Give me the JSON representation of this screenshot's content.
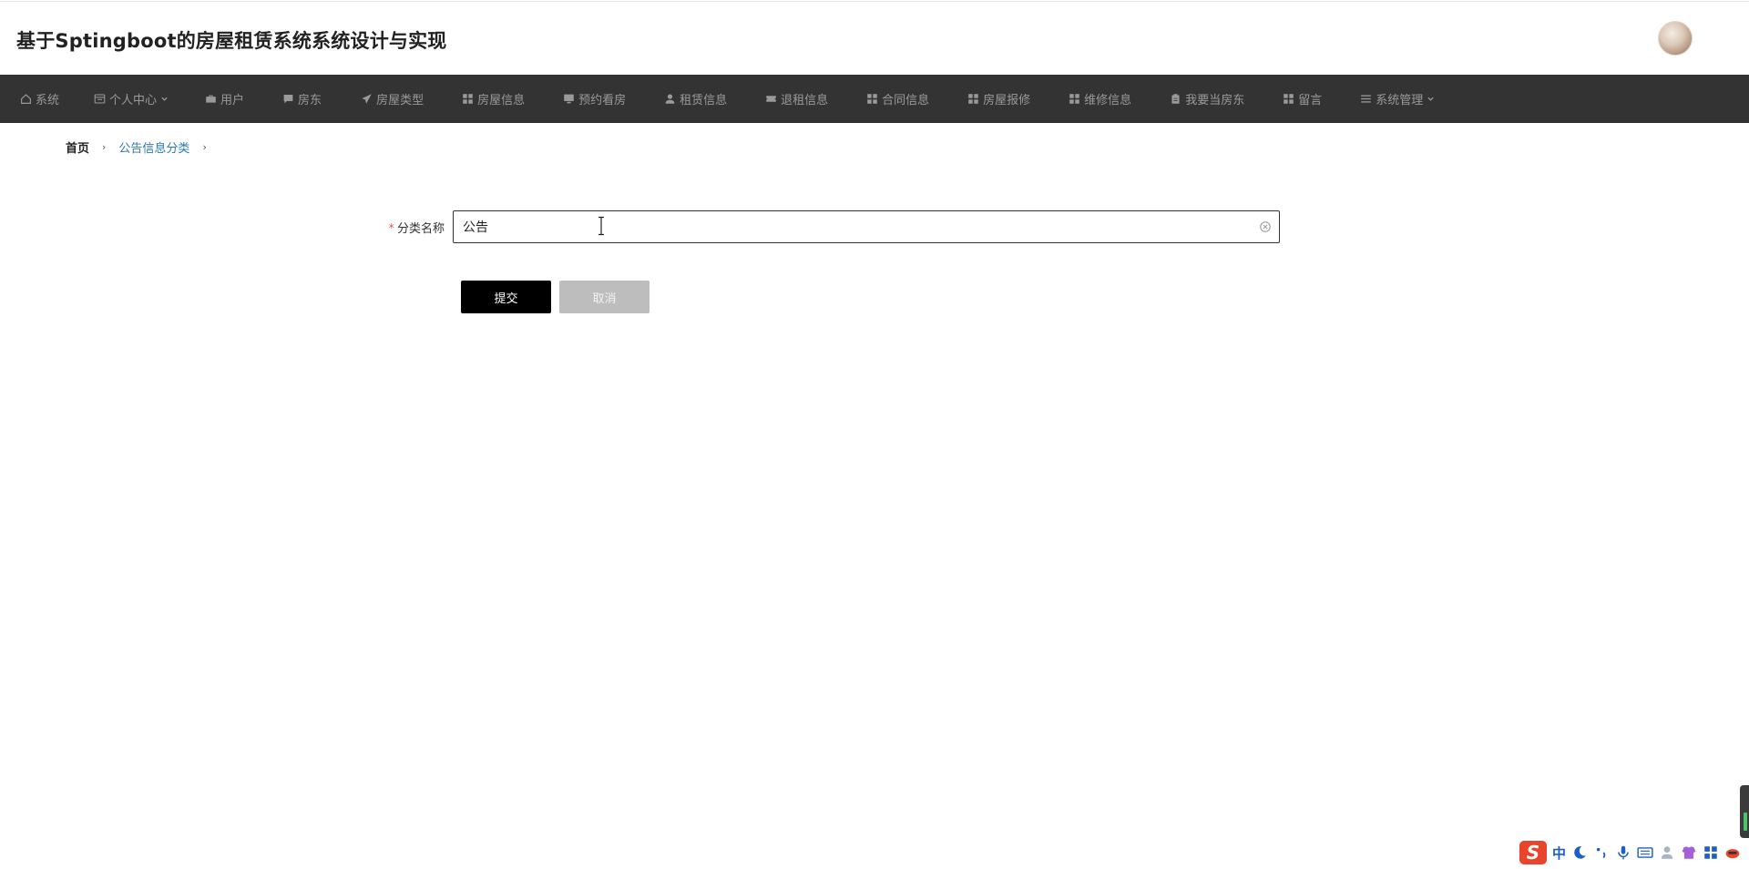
{
  "app": {
    "title": "基于Sptingboot的房屋租赁系统系统设计与实现"
  },
  "nav": {
    "items": [
      {
        "label": "系统",
        "icon": "home-icon"
      },
      {
        "label": "个人中心",
        "icon": "calendar-icon",
        "has_dropdown": true
      },
      {
        "label": "用户",
        "icon": "briefcase-icon"
      },
      {
        "label": "房东",
        "icon": "chat-icon"
      },
      {
        "label": "房屋类型",
        "icon": "send-icon"
      },
      {
        "label": "房屋信息",
        "icon": "grid-icon"
      },
      {
        "label": "预约看房",
        "icon": "monitor-icon"
      },
      {
        "label": "租赁信息",
        "icon": "person-icon"
      },
      {
        "label": "退租信息",
        "icon": "ticket-icon"
      },
      {
        "label": "合同信息",
        "icon": "grid-icon"
      },
      {
        "label": "房屋报修",
        "icon": "grid-icon"
      },
      {
        "label": "维修信息",
        "icon": "grid-icon"
      },
      {
        "label": "我要当房东",
        "icon": "clipboard-icon"
      },
      {
        "label": "留言",
        "icon": "grid-icon"
      },
      {
        "label": "系统管理",
        "icon": "menu-icon",
        "has_dropdown": true
      }
    ]
  },
  "breadcrumb": {
    "home": "首页",
    "current": "公告信息分类",
    "separator": "›"
  },
  "form": {
    "required_mark": "*",
    "category_label": "分类名称",
    "category_value": "公告",
    "submit_label": "提交",
    "cancel_label": "取消"
  },
  "ime": {
    "mode_text": "中",
    "logo": "S"
  },
  "colors": {
    "navbar_bg": "#333333",
    "nav_text": "#9a9a9a",
    "breadcrumb_current": "#2a7ab0",
    "required": "#e25b5b",
    "submit_bg": "#000000",
    "cancel_bg": "#bdbdbd"
  }
}
